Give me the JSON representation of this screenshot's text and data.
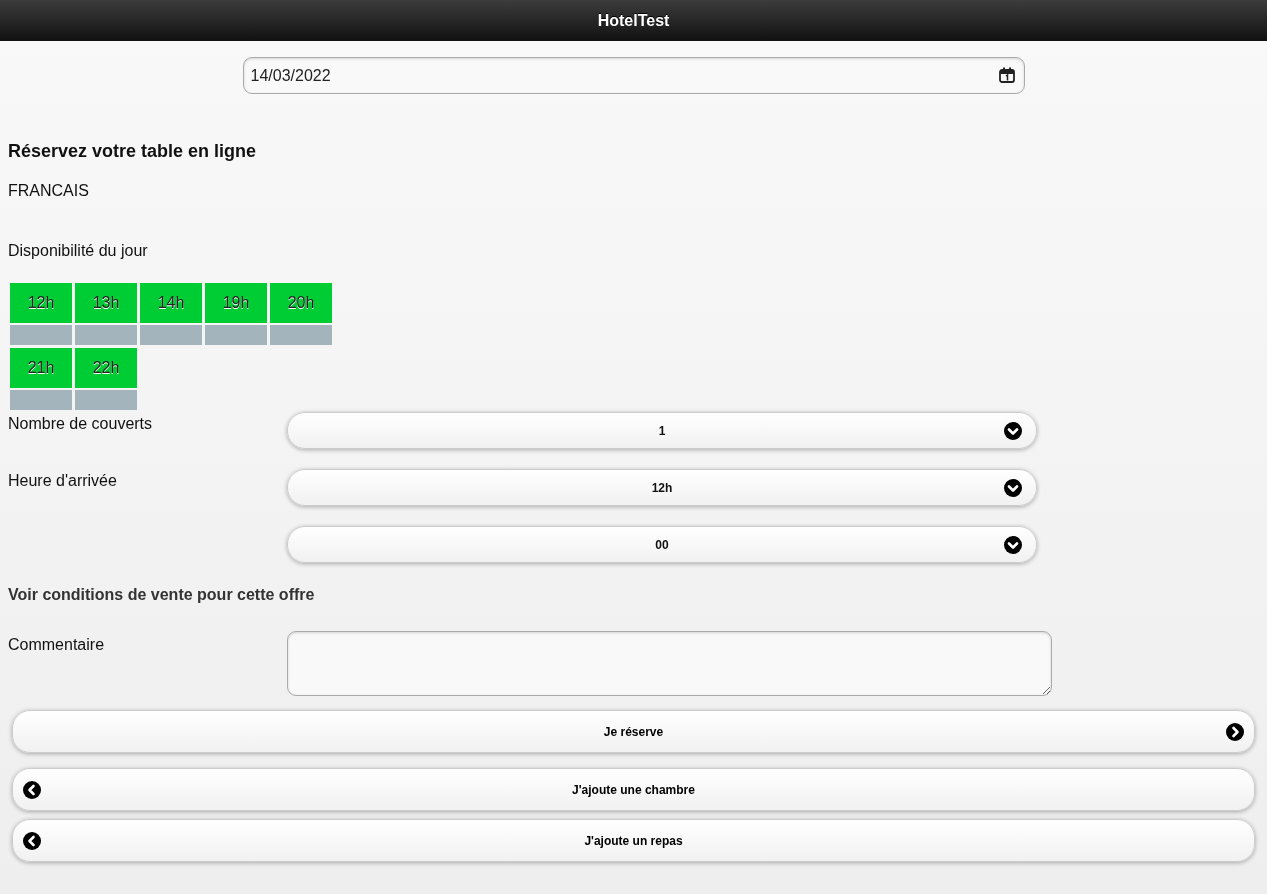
{
  "header": {
    "title": "HotelTest"
  },
  "date_field": {
    "value": "14/03/2022"
  },
  "heading": "Réservez votre table en ligne",
  "language": "FRANCAIS",
  "availability_label": "Disponibilité du jour",
  "slots": [
    {
      "label": "12h"
    },
    {
      "label": "13h"
    },
    {
      "label": "14h"
    },
    {
      "label": "19h"
    },
    {
      "label": "20h"
    },
    {
      "label": "21h"
    },
    {
      "label": "22h"
    }
  ],
  "selects": [
    {
      "label": "Nombre de couverts",
      "value": "1"
    },
    {
      "label": "Heure d'arrivée",
      "value": "12h"
    },
    {
      "value": "00"
    }
  ],
  "conditions_link": "Voir conditions de vente pour cette offre",
  "comment": {
    "label": "Commentaire"
  },
  "buttons": [
    {
      "label": "Je réserve",
      "kind": "forward"
    },
    {
      "label": "J'ajoute une chambre",
      "kind": "back"
    },
    {
      "label": "J'ajoute un repas",
      "kind": "back"
    }
  ]
}
